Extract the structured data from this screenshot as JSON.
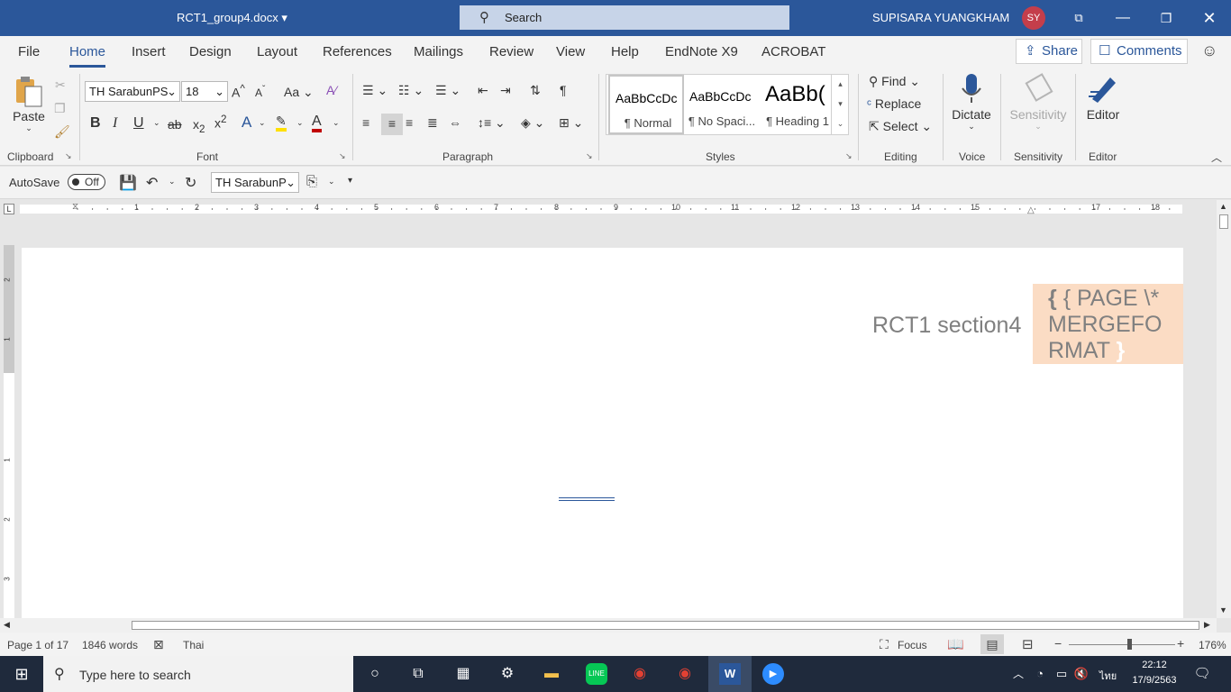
{
  "titlebar": {
    "doc_title": "RCT1_group4.docx",
    "search_placeholder": "Search",
    "user_name": "SUPISARA YUANGKHAM",
    "user_initials": "SY"
  },
  "tabs": [
    "File",
    "Home",
    "Insert",
    "Design",
    "Layout",
    "References",
    "Mailings",
    "Review",
    "View",
    "Help",
    "EndNote X9",
    "ACROBAT"
  ],
  "share_label": "Share",
  "comments_label": "Comments",
  "ribbon": {
    "clipboard": {
      "paste": "Paste",
      "label": "Clipboard"
    },
    "font": {
      "name": "TH SarabunPSK",
      "size": "18",
      "label": "Font"
    },
    "paragraph": {
      "label": "Paragraph"
    },
    "styles": {
      "label": "Styles",
      "items": [
        {
          "sample": "AaBbCcDc",
          "name": "¶ Normal"
        },
        {
          "sample": "AaBbCcDc",
          "name": "¶ No Spaci..."
        },
        {
          "sample": "AaBb(",
          "name": "¶ Heading 1"
        }
      ]
    },
    "editing": {
      "find": "Find",
      "replace": "Replace",
      "select": "Select",
      "label": "Editing"
    },
    "voice": {
      "dictate": "Dictate",
      "label": "Voice"
    },
    "sensitivity": {
      "button": "Sensitivity",
      "label": "Sensitivity"
    },
    "editor": {
      "button": "Editor",
      "label": "Editor"
    }
  },
  "qat": {
    "autosave": "AutoSave",
    "toggle": "Off",
    "font": "TH SarabunP"
  },
  "ruler": [
    "1",
    "2",
    "3",
    "4",
    "5",
    "6",
    "7",
    "8",
    "9",
    "10",
    "11",
    "12",
    "13",
    "14",
    "15",
    "16",
    "17",
    "18"
  ],
  "vruler": [
    "2",
    "1",
    "1",
    "2",
    "3"
  ],
  "document": {
    "header_text": "RCT1 section4",
    "field_code_line1": "{ PAGE   \\*",
    "field_code_line2": "MERGEFO",
    "field_code_line3": "RMAT",
    "field_close": "}"
  },
  "status": {
    "page": "Page 1 of 17",
    "words": "1846 words",
    "language": "Thai",
    "focus": "Focus",
    "zoom": "176%"
  },
  "taskbar": {
    "search_placeholder": "Type here to search",
    "time": "22:12",
    "date": "17/9/2563",
    "ime": "ไทย"
  },
  "colors": {
    "accent": "#2b579a",
    "field_bg": "#fbdcc4",
    "avatar": "#c43e4b"
  }
}
